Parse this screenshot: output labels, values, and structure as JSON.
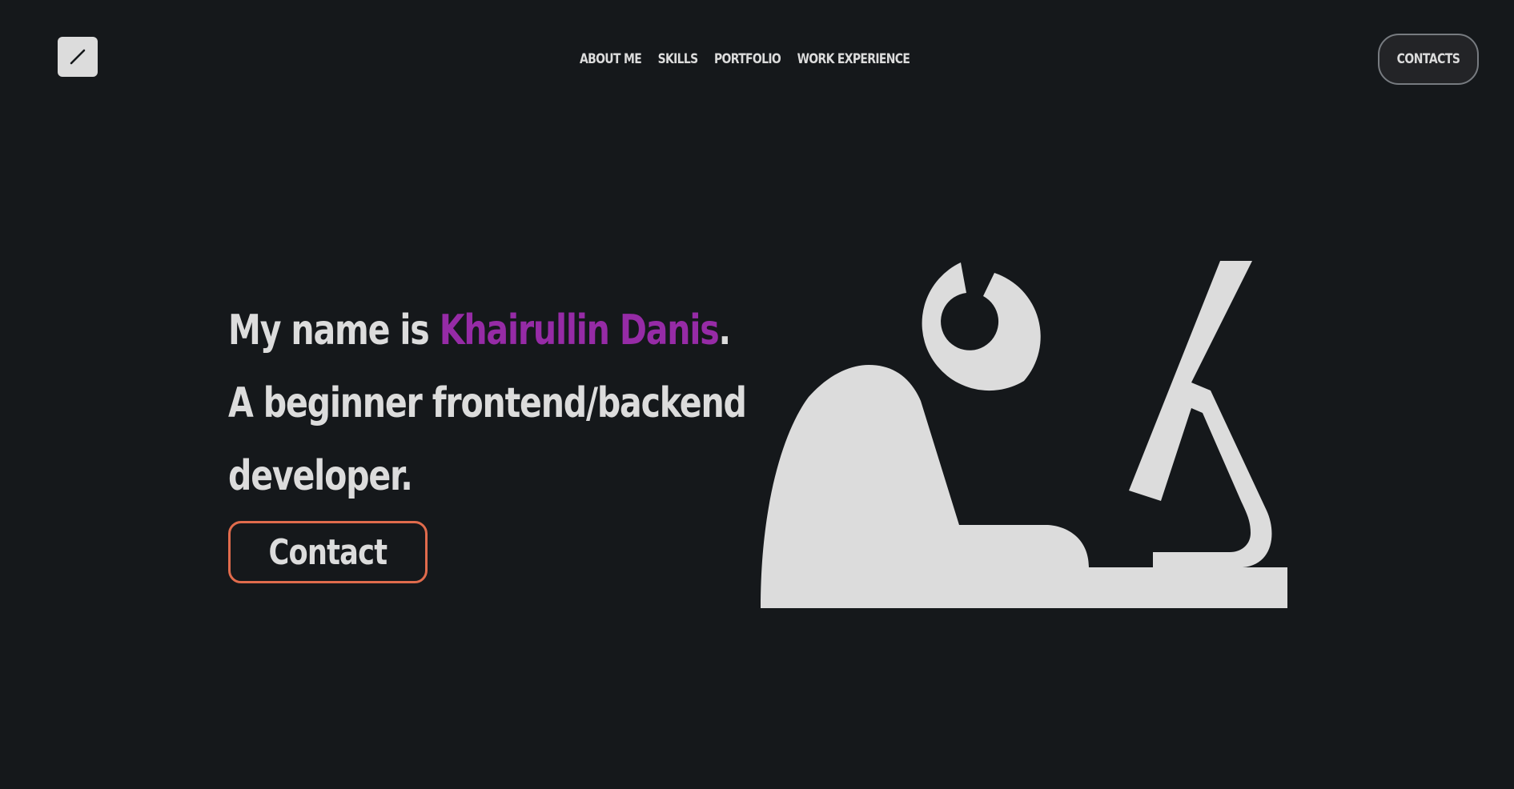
{
  "header": {
    "logo_icon": "slash-icon",
    "nav": [
      {
        "label": "ABOUT ME"
      },
      {
        "label": "SKILLS"
      },
      {
        "label": "PORTFOLIO"
      },
      {
        "label": "WORK EXPERIENCE"
      }
    ],
    "contacts_label": "CONTACTS"
  },
  "hero": {
    "intro_prefix": "My name is ",
    "name": "Khairullin Danis",
    "intro_suffix": ".",
    "line2": "A beginner frontend/backend",
    "line3": "developer.",
    "cta_label": "Contact"
  },
  "illustration": {
    "icon": "developer-at-computer-icon"
  },
  "colors": {
    "background": "#15181b",
    "text": "#dcdcdc",
    "accent_name": "#962ba6",
    "cta_border": "#e06b4c",
    "contacts_border": "#777b80"
  }
}
